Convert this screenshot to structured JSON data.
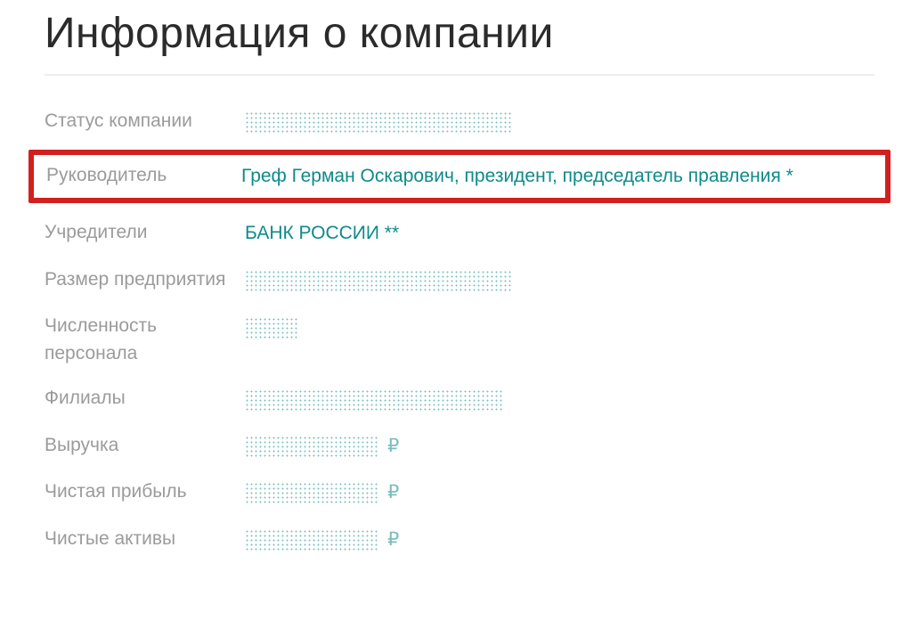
{
  "title": "Информация о компании",
  "rows": {
    "status": {
      "label": "Статус компании"
    },
    "head": {
      "label": "Руководитель",
      "value": "Греф Герман Оскарович, президент, председатель правления *"
    },
    "founders": {
      "label": "Учредители",
      "value": "БАНК РОССИИ **"
    },
    "size": {
      "label": "Размер предприятия"
    },
    "staff": {
      "label": "Численность персонала"
    },
    "branches": {
      "label": "Филиалы"
    },
    "revenue": {
      "label": "Выручка",
      "currency": "₽"
    },
    "profit": {
      "label": "Чистая прибыль",
      "currency": "₽"
    },
    "assets": {
      "label": "Чистые активы",
      "currency": "₽"
    }
  }
}
